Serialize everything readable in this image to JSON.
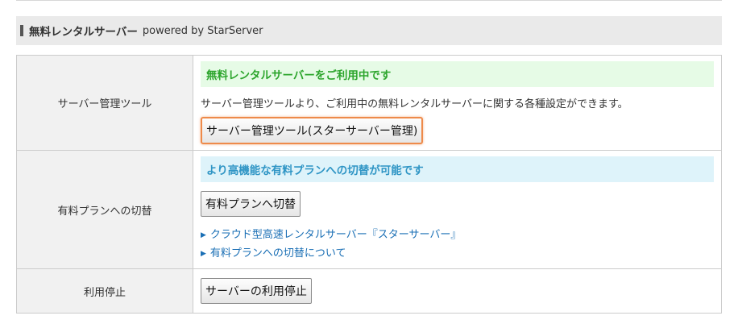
{
  "header": {
    "title": "無料レンタルサーバー",
    "subtitle": "powered by StarServer"
  },
  "rows": [
    {
      "label": "サーバー管理ツール",
      "banner": "無料レンタルサーバーをご利用中です",
      "description": "サーバー管理ツールより、ご利用中の無料レンタルサーバーに関する各種設定ができます。",
      "button": "サーバー管理ツール(スターサーバー管理)"
    },
    {
      "label": "有料プランへの切替",
      "banner": "より高機能な有料プランへの切替が可能です",
      "button": "有料プランへ切替",
      "links": [
        "クラウド型高速レンタルサーバー『スターサーバー』",
        "有料プランへの切替について"
      ]
    },
    {
      "label": "利用停止",
      "button": "サーバーの利用停止"
    }
  ],
  "colors": {
    "highlight_border": "#ee8a4a",
    "green_banner_text": "#2ca52c",
    "blue_banner_text": "#2f95c5",
    "link": "#1a6fb5"
  }
}
